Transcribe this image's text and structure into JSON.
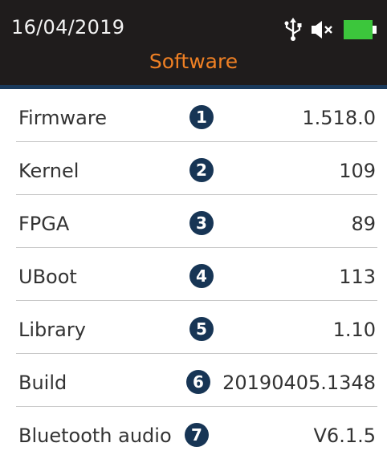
{
  "header": {
    "date": "16/04/2019",
    "title": "Software",
    "title_color": "#ef8024",
    "background_color": "#1f1c1c",
    "status_icons": [
      "usb-icon",
      "speaker-muted-icon",
      "battery-full-icon"
    ],
    "battery_level": 1.0,
    "battery_color": "#3cc63c"
  },
  "accent_line_color": "#1a3a5c",
  "badge_color": "#173555",
  "rows": [
    {
      "label": "Firmware",
      "badge": "1",
      "value": "1.518.0"
    },
    {
      "label": "Kernel",
      "badge": "2",
      "value": "109"
    },
    {
      "label": "FPGA",
      "badge": "3",
      "value": "89"
    },
    {
      "label": "UBoot",
      "badge": "4",
      "value": "113"
    },
    {
      "label": "Library",
      "badge": "5",
      "value": "1.10"
    },
    {
      "label": "Build",
      "badge": "6",
      "value": "20190405.1348"
    },
    {
      "label": "Bluetooth audio",
      "badge": "7",
      "value": "V6.1.5"
    }
  ]
}
